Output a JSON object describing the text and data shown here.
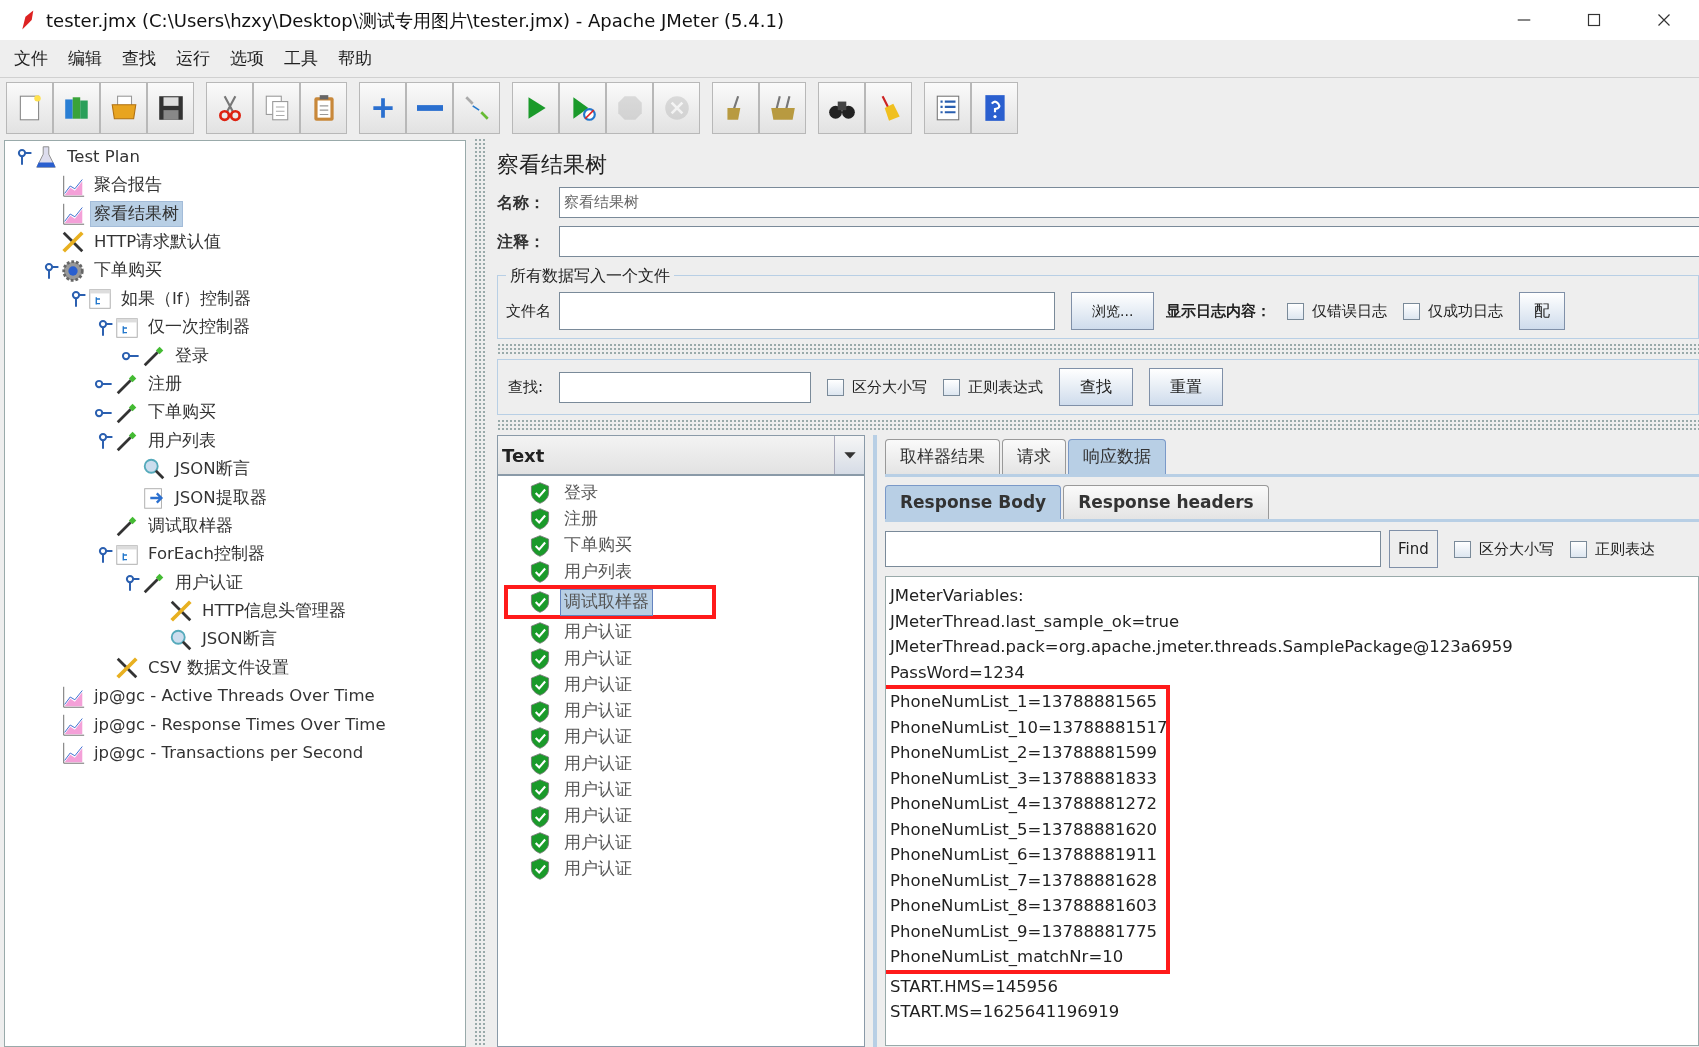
{
  "window": {
    "title": "tester.jmx (C:\\Users\\hzxy\\Desktop\\测试专用图片\\tester.jmx) - Apache JMeter (5.4.1)"
  },
  "menu": [
    "文件",
    "编辑",
    "查找",
    "运行",
    "选项",
    "工具",
    "帮助"
  ],
  "toolbar": [
    [
      {
        "kind": "new",
        "disabled": false
      },
      {
        "kind": "templates",
        "disabled": false
      },
      {
        "kind": "open",
        "disabled": false
      },
      {
        "kind": "save",
        "disabled": false
      }
    ],
    [
      {
        "kind": "cut",
        "disabled": false
      },
      {
        "kind": "copy",
        "disabled": false
      },
      {
        "kind": "paste",
        "disabled": false
      }
    ],
    [
      {
        "kind": "expand",
        "disabled": false
      },
      {
        "kind": "collapse",
        "disabled": false
      },
      {
        "kind": "toggle",
        "disabled": false
      }
    ],
    [
      {
        "kind": "start",
        "disabled": false
      },
      {
        "kind": "start_no_pause",
        "disabled": false
      },
      {
        "kind": "stop",
        "disabled": true
      },
      {
        "kind": "shutdown",
        "disabled": true
      }
    ],
    [
      {
        "kind": "clear",
        "disabled": false
      },
      {
        "kind": "clear_all",
        "disabled": false
      }
    ],
    [
      {
        "kind": "search",
        "disabled": false
      },
      {
        "kind": "reset_search",
        "disabled": false
      }
    ],
    [
      {
        "kind": "function_helper",
        "disabled": false
      },
      {
        "kind": "help",
        "disabled": false
      }
    ]
  ],
  "tree": [
    {
      "label": "Test Plan",
      "kind": "plan",
      "selected": false,
      "expanded": true,
      "children": [
        {
          "label": "聚合报告",
          "kind": "listener",
          "selected": false
        },
        {
          "label": "察看结果树",
          "kind": "listener",
          "selected": true
        },
        {
          "label": "HTTP请求默认值",
          "kind": "config",
          "selected": false
        },
        {
          "label": "下单购买",
          "kind": "thread_group",
          "selected": false,
          "expanded": true,
          "children": [
            {
              "label": "如果（If）控制器",
              "kind": "controller",
              "selected": false,
              "expanded": true,
              "children": [
                {
                  "label": "仅一次控制器",
                  "kind": "controller",
                  "selected": false,
                  "expanded": true,
                  "children": [
                    {
                      "label": "登录",
                      "kind": "sampler",
                      "selected": false,
                      "expanded": false
                    }
                  ]
                },
                {
                  "label": "注册",
                  "kind": "sampler",
                  "selected": false,
                  "expanded": false
                },
                {
                  "label": "下单购买",
                  "kind": "sampler",
                  "selected": false,
                  "expanded": false
                },
                {
                  "label": "用户列表",
                  "kind": "sampler",
                  "selected": false,
                  "expanded": true,
                  "children": [
                    {
                      "label": "JSON断言",
                      "kind": "assertion",
                      "selected": false
                    },
                    {
                      "label": "JSON提取器",
                      "kind": "extractor",
                      "selected": false
                    }
                  ]
                },
                {
                  "label": "调试取样器",
                  "kind": "sampler",
                  "selected": false
                },
                {
                  "label": "ForEach控制器",
                  "kind": "controller",
                  "selected": false,
                  "expanded": true,
                  "children": [
                    {
                      "label": "用户认证",
                      "kind": "sampler",
                      "selected": false,
                      "expanded": true,
                      "children": [
                        {
                          "label": "HTTP信息头管理器",
                          "kind": "config",
                          "selected": false
                        },
                        {
                          "label": "JSON断言",
                          "kind": "assertion",
                          "selected": false
                        }
                      ]
                    }
                  ]
                },
                {
                  "label": "CSV 数据文件设置",
                  "kind": "config",
                  "selected": false
                }
              ]
            }
          ]
        },
        {
          "label": "jp@gc - Active Threads Over Time",
          "kind": "listener",
          "selected": false
        },
        {
          "label": "jp@gc - Response Times Over Time",
          "kind": "listener",
          "selected": false
        },
        {
          "label": "jp@gc - Transactions per Second",
          "kind": "listener",
          "selected": false
        }
      ]
    }
  ],
  "panel": {
    "title": "察看结果树",
    "name_label": "名称：",
    "name_value": "察看结果树",
    "comment_label": "注释：",
    "file_group": {
      "legend": "所有数据写入一个文件",
      "filename_label": "文件名",
      "browse_button": "浏览...",
      "log_label": "显示日志内容：",
      "checkboxes": [
        {
          "label": "仅错误日志",
          "checked": false
        },
        {
          "label": "仅成功日志",
          "checked": false
        }
      ],
      "config_button": "配"
    },
    "search": {
      "label": "查找:",
      "checkboxes": [
        {
          "label": "区分大小写",
          "checked": false
        },
        {
          "label": "正则表达式",
          "checked": false
        }
      ],
      "find_button": "查找",
      "reset_button": "重置"
    },
    "renderer": "Text",
    "results": [
      {
        "label": "登录",
        "selected": false,
        "highlighted": false
      },
      {
        "label": "注册",
        "selected": false,
        "highlighted": false
      },
      {
        "label": "下单购买",
        "selected": false,
        "highlighted": false
      },
      {
        "label": "用户列表",
        "selected": false,
        "highlighted": false
      },
      {
        "label": "调试取样器",
        "selected": true,
        "highlighted": true
      },
      {
        "label": "用户认证",
        "selected": false,
        "highlighted": false
      },
      {
        "label": "用户认证",
        "selected": false,
        "highlighted": false
      },
      {
        "label": "用户认证",
        "selected": false,
        "highlighted": false
      },
      {
        "label": "用户认证",
        "selected": false,
        "highlighted": false
      },
      {
        "label": "用户认证",
        "selected": false,
        "highlighted": false
      },
      {
        "label": "用户认证",
        "selected": false,
        "highlighted": false
      },
      {
        "label": "用户认证",
        "selected": false,
        "highlighted": false
      },
      {
        "label": "用户认证",
        "selected": false,
        "highlighted": false
      },
      {
        "label": "用户认证",
        "selected": false,
        "highlighted": false
      },
      {
        "label": "用户认证",
        "selected": false,
        "highlighted": false
      }
    ],
    "tabs": [
      {
        "label": "取样器结果",
        "selected": false
      },
      {
        "label": "请求",
        "selected": false
      },
      {
        "label": "响应数据",
        "selected": true
      }
    ],
    "subtabs": [
      {
        "label": "Response Body",
        "selected": true
      },
      {
        "label": "Response headers",
        "selected": false
      }
    ],
    "response_find": {
      "button": "Find",
      "checkboxes": [
        {
          "label": "区分大小写",
          "checked": false
        },
        {
          "label": "正则表达",
          "checked": false
        }
      ]
    },
    "response_lines": [
      {
        "text": "JMeterVariables:",
        "highlighted": false
      },
      {
        "text": "JMeterThread.last_sample_ok=true",
        "highlighted": false
      },
      {
        "text": "JMeterThread.pack=org.apache.jmeter.threads.SamplePackage@123a6959",
        "highlighted": false
      },
      {
        "text": "PassWord=1234",
        "highlighted": false
      },
      {
        "kind": "highlight_group",
        "lines": [
          "PhoneNumList_1=13788881565",
          "PhoneNumList_10=13788881517",
          "PhoneNumList_2=13788881599",
          "PhoneNumList_3=13788881833",
          "PhoneNumList_4=13788881272",
          "PhoneNumList_5=13788881620",
          "PhoneNumList_6=13788881911",
          "PhoneNumList_7=13788881628",
          "PhoneNumList_8=13788881603",
          "PhoneNumList_9=13788881775",
          "PhoneNumList_matchNr=10"
        ]
      },
      {
        "text": "START.HMS=145956",
        "highlighted": false
      },
      {
        "text": "START.MS=1625641196919",
        "highlighted": false
      }
    ]
  }
}
